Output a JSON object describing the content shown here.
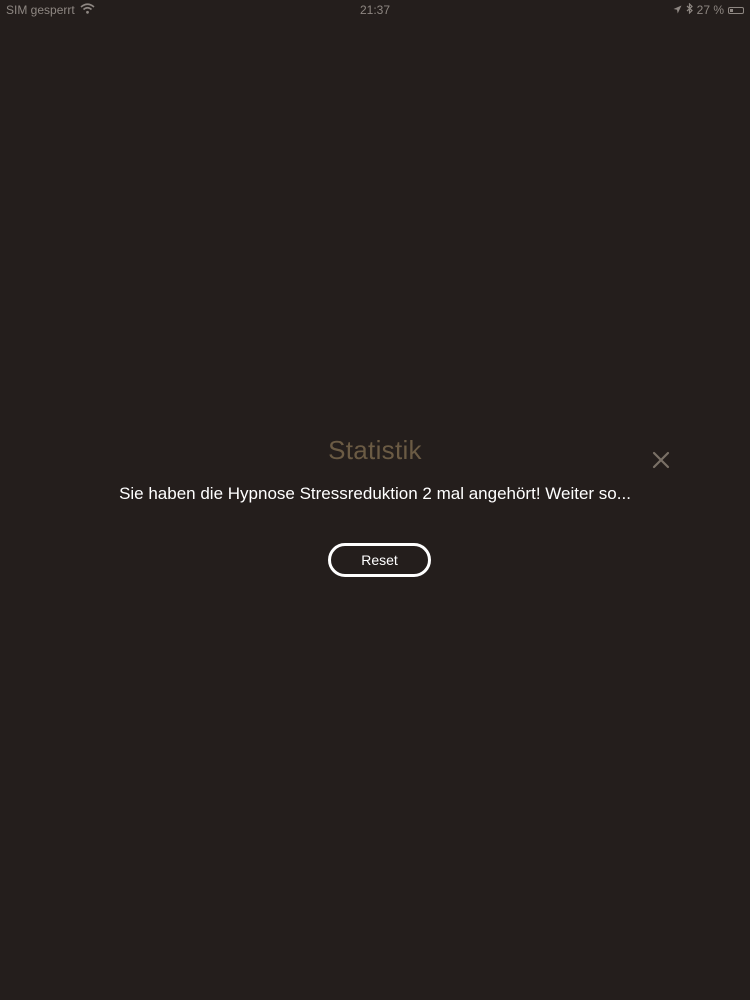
{
  "status_bar": {
    "carrier": "SIM gesperrt",
    "wifi_icon": "wifi-icon",
    "time": "21:37",
    "location_icon": "location-arrow-icon",
    "bluetooth_icon": "bluetooth-icon",
    "battery_percent_label": "27 %",
    "battery_level": 0.27
  },
  "dialog": {
    "title": "Statistik",
    "close_icon": "close-icon",
    "message": "Sie haben die Hypnose Stressreduktion 2 mal angehört! Weiter so...",
    "reset_label": "Reset"
  },
  "colors": {
    "background": "#241e1c",
    "title": "#6b5b44",
    "close_icon": "#7a7066",
    "text": "#ffffff",
    "status_text": "#8e8782"
  }
}
